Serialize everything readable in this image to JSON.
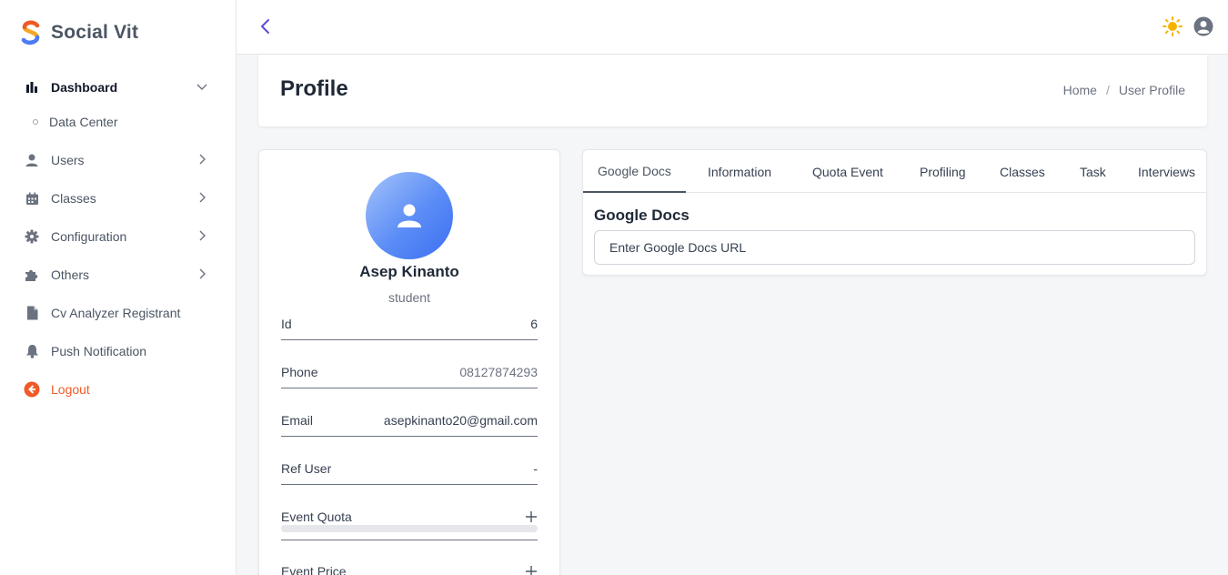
{
  "app": {
    "name": "Social Vit"
  },
  "sidebar": {
    "items": [
      {
        "label": "Dashboard",
        "icon": "bar-chart-icon"
      },
      {
        "label": "Data Center",
        "icon": "circle-dot-icon"
      },
      {
        "label": "Users",
        "icon": "user-icon"
      },
      {
        "label": "Classes",
        "icon": "calendar-icon"
      },
      {
        "label": "Configuration",
        "icon": "gear-icon"
      },
      {
        "label": "Others",
        "icon": "puzzle-icon"
      },
      {
        "label": "Cv Analyzer Registrant",
        "icon": "document-icon"
      },
      {
        "label": "Push Notification",
        "icon": "bell-icon"
      },
      {
        "label": "Logout",
        "icon": "logout-icon"
      }
    ]
  },
  "header": {
    "title": "Profile",
    "breadcrumb": {
      "home": "Home",
      "separator": "/",
      "current": "User Profile"
    }
  },
  "profile": {
    "name": "Asep Kinanto",
    "role": "student",
    "fields": {
      "id": {
        "label": "Id",
        "value": "6"
      },
      "phone": {
        "label": "Phone",
        "value": "08127874293"
      },
      "email": {
        "label": "Email",
        "value": "asepkinanto20@gmail.com"
      },
      "ref_user": {
        "label": "Ref User",
        "value": "-"
      },
      "event_quota": {
        "label": "Event Quota",
        "progress": 0
      },
      "event_price": {
        "label": "Event Price"
      }
    }
  },
  "tabs": {
    "items": [
      "Google Docs",
      "Information",
      "Quota Event",
      "Profiling",
      "Classes",
      "Task",
      "Interviews"
    ],
    "active": "Google Docs"
  },
  "google_docs": {
    "title": "Google Docs",
    "placeholder": "Enter Google Docs URL"
  },
  "colors": {
    "accent": "#5b4bdb",
    "logout": "#f05a28",
    "theme_icon": "#f5b301",
    "avatar_gradient_start": "#a5c4fb",
    "avatar_gradient_end": "#3b6ff2"
  }
}
